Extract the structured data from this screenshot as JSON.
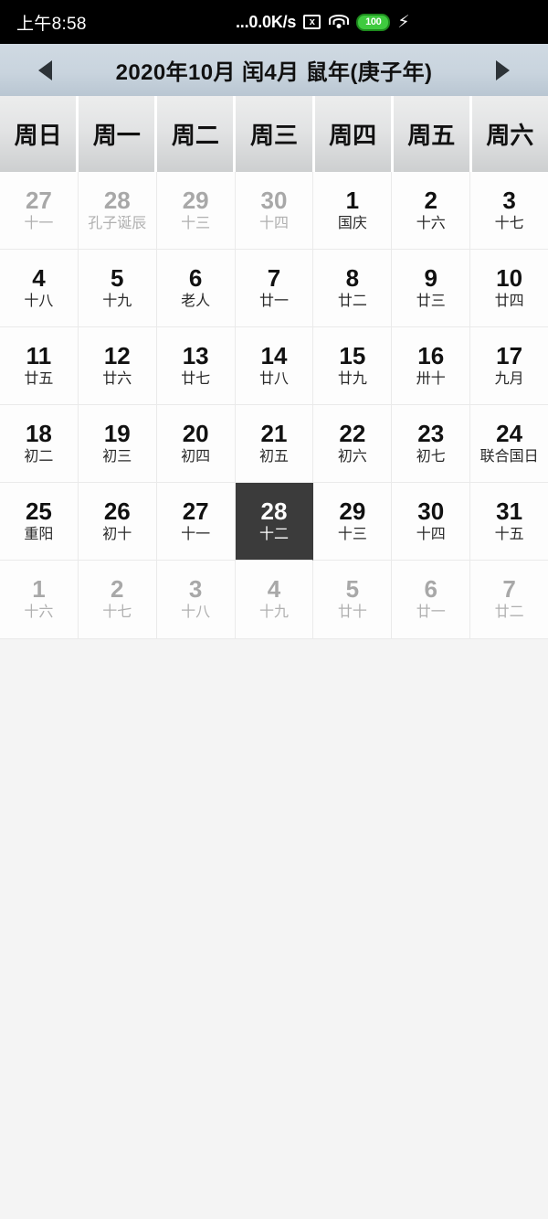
{
  "status_bar": {
    "time": "上午8:58",
    "network_speed": "...0.0K/s",
    "signal_icon_label": "x",
    "battery_level": "100",
    "icons": [
      "signal-off-icon",
      "wifi-icon",
      "battery-icon",
      "charging-bolt-icon"
    ],
    "battery_color": "#3fca3f",
    "background_color": "#000000"
  },
  "title_bar": {
    "prev_label": "◀",
    "next_label": "▶",
    "title": "2020年10月 闰4月 鼠年(庚子年)",
    "background_color": "#c9d4de"
  },
  "weekdays": [
    "周日",
    "周一",
    "周二",
    "周三",
    "周四",
    "周五",
    "周六"
  ],
  "calendar": {
    "selected_day": "28",
    "selected_color": "#3b3b3b",
    "rows": [
      [
        {
          "day": "27",
          "lunar": "十一",
          "other": true
        },
        {
          "day": "28",
          "lunar": "孔子诞辰",
          "other": true
        },
        {
          "day": "29",
          "lunar": "十三",
          "other": true
        },
        {
          "day": "30",
          "lunar": "十四",
          "other": true
        },
        {
          "day": "1",
          "lunar": "国庆",
          "other": false
        },
        {
          "day": "2",
          "lunar": "十六",
          "other": false
        },
        {
          "day": "3",
          "lunar": "十七",
          "other": false
        }
      ],
      [
        {
          "day": "4",
          "lunar": "十八",
          "other": false
        },
        {
          "day": "5",
          "lunar": "十九",
          "other": false
        },
        {
          "day": "6",
          "lunar": "老人",
          "other": false
        },
        {
          "day": "7",
          "lunar": "廿一",
          "other": false
        },
        {
          "day": "8",
          "lunar": "廿二",
          "other": false
        },
        {
          "day": "9",
          "lunar": "廿三",
          "other": false
        },
        {
          "day": "10",
          "lunar": "廿四",
          "other": false
        }
      ],
      [
        {
          "day": "11",
          "lunar": "廿五",
          "other": false
        },
        {
          "day": "12",
          "lunar": "廿六",
          "other": false
        },
        {
          "day": "13",
          "lunar": "廿七",
          "other": false
        },
        {
          "day": "14",
          "lunar": "廿八",
          "other": false
        },
        {
          "day": "15",
          "lunar": "廿九",
          "other": false
        },
        {
          "day": "16",
          "lunar": "卅十",
          "other": false
        },
        {
          "day": "17",
          "lunar": "九月",
          "other": false
        }
      ],
      [
        {
          "day": "18",
          "lunar": "初二",
          "other": false
        },
        {
          "day": "19",
          "lunar": "初三",
          "other": false
        },
        {
          "day": "20",
          "lunar": "初四",
          "other": false
        },
        {
          "day": "21",
          "lunar": "初五",
          "other": false
        },
        {
          "day": "22",
          "lunar": "初六",
          "other": false
        },
        {
          "day": "23",
          "lunar": "初七",
          "other": false
        },
        {
          "day": "24",
          "lunar": "联合国日",
          "other": false
        }
      ],
      [
        {
          "day": "25",
          "lunar": "重阳",
          "other": false
        },
        {
          "day": "26",
          "lunar": "初十",
          "other": false
        },
        {
          "day": "27",
          "lunar": "十一",
          "other": false
        },
        {
          "day": "28",
          "lunar": "十二",
          "other": false,
          "selected": true
        },
        {
          "day": "29",
          "lunar": "十三",
          "other": false
        },
        {
          "day": "30",
          "lunar": "十四",
          "other": false
        },
        {
          "day": "31",
          "lunar": "十五",
          "other": false
        }
      ],
      [
        {
          "day": "1",
          "lunar": "十六",
          "other": true
        },
        {
          "day": "2",
          "lunar": "十七",
          "other": true
        },
        {
          "day": "3",
          "lunar": "十八",
          "other": true
        },
        {
          "day": "4",
          "lunar": "十九",
          "other": true
        },
        {
          "day": "5",
          "lunar": "廿十",
          "other": true
        },
        {
          "day": "6",
          "lunar": "廿一",
          "other": true
        },
        {
          "day": "7",
          "lunar": "廿二",
          "other": true
        }
      ]
    ]
  }
}
